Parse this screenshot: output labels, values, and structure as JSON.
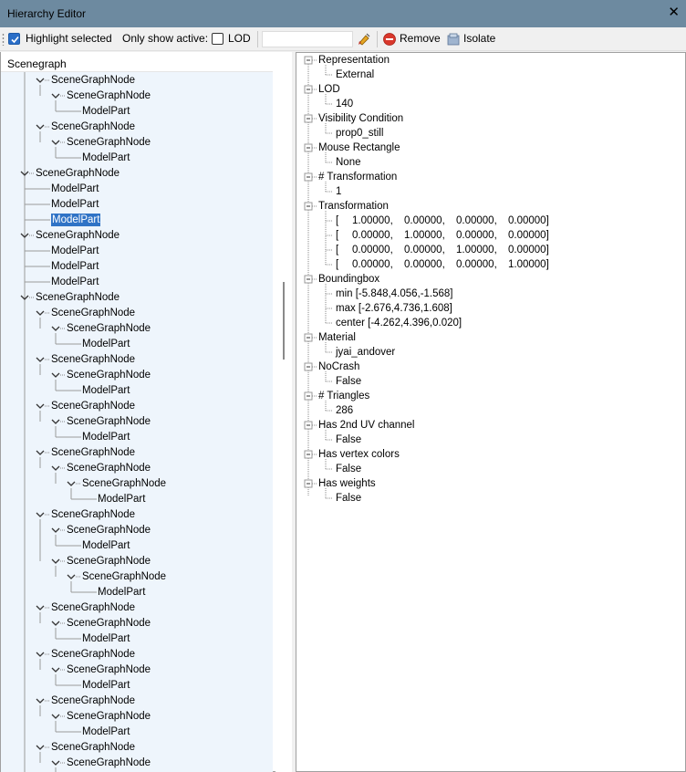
{
  "window": {
    "title": "Hierarchy Editor",
    "close_symbol": "✕"
  },
  "toolbar": {
    "highlight_label": "Highlight selected",
    "only_active_label": "Only show active:",
    "lod_label": "LOD",
    "search_value": "",
    "remove_label": "Remove",
    "isolate_label": "Isolate"
  },
  "tree": {
    "header": "Scenegraph",
    "rows": [
      {
        "level": 1,
        "label": "SceneGraphNode",
        "expander": "expanded"
      },
      {
        "level": 2,
        "label": "SceneGraphNode",
        "expander": "expanded"
      },
      {
        "level": 3,
        "label": "ModelPart",
        "expander": "none"
      },
      {
        "level": 1,
        "label": "SceneGraphNode",
        "expander": "expanded"
      },
      {
        "level": 2,
        "label": "SceneGraphNode",
        "expander": "expanded"
      },
      {
        "level": 3,
        "label": "ModelPart",
        "expander": "none"
      },
      {
        "level": 0,
        "label": "SceneGraphNode",
        "expander": "expanded"
      },
      {
        "level": 1,
        "label": "ModelPart",
        "expander": "none"
      },
      {
        "level": 1,
        "label": "ModelPart",
        "expander": "none"
      },
      {
        "level": 1,
        "label": "ModelPart",
        "expander": "none",
        "selected": true
      },
      {
        "level": 0,
        "label": "SceneGraphNode",
        "expander": "expanded"
      },
      {
        "level": 1,
        "label": "ModelPart",
        "expander": "none"
      },
      {
        "level": 1,
        "label": "ModelPart",
        "expander": "none"
      },
      {
        "level": 1,
        "label": "ModelPart",
        "expander": "none"
      },
      {
        "level": 0,
        "label": "SceneGraphNode",
        "expander": "expanded"
      },
      {
        "level": 1,
        "label": "SceneGraphNode",
        "expander": "expanded"
      },
      {
        "level": 2,
        "label": "SceneGraphNode",
        "expander": "expanded"
      },
      {
        "level": 3,
        "label": "ModelPart",
        "expander": "none"
      },
      {
        "level": 1,
        "label": "SceneGraphNode",
        "expander": "expanded"
      },
      {
        "level": 2,
        "label": "SceneGraphNode",
        "expander": "expanded"
      },
      {
        "level": 3,
        "label": "ModelPart",
        "expander": "none"
      },
      {
        "level": 1,
        "label": "SceneGraphNode",
        "expander": "expanded"
      },
      {
        "level": 2,
        "label": "SceneGraphNode",
        "expander": "expanded"
      },
      {
        "level": 3,
        "label": "ModelPart",
        "expander": "none"
      },
      {
        "level": 1,
        "label": "SceneGraphNode",
        "expander": "expanded"
      },
      {
        "level": 2,
        "label": "SceneGraphNode",
        "expander": "expanded"
      },
      {
        "level": 3,
        "label": "SceneGraphNode",
        "expander": "expanded"
      },
      {
        "level": 4,
        "label": "ModelPart",
        "expander": "none"
      },
      {
        "level": 1,
        "label": "SceneGraphNode",
        "expander": "expanded"
      },
      {
        "level": 2,
        "label": "SceneGraphNode",
        "expander": "expanded"
      },
      {
        "level": 3,
        "label": "ModelPart",
        "expander": "none"
      },
      {
        "level": 2,
        "label": "SceneGraphNode",
        "expander": "expanded"
      },
      {
        "level": 3,
        "label": "SceneGraphNode",
        "expander": "expanded"
      },
      {
        "level": 4,
        "label": "ModelPart",
        "expander": "none"
      },
      {
        "level": 1,
        "label": "SceneGraphNode",
        "expander": "expanded"
      },
      {
        "level": 2,
        "label": "SceneGraphNode",
        "expander": "expanded"
      },
      {
        "level": 3,
        "label": "ModelPart",
        "expander": "none"
      },
      {
        "level": 1,
        "label": "SceneGraphNode",
        "expander": "expanded"
      },
      {
        "level": 2,
        "label": "SceneGraphNode",
        "expander": "expanded"
      },
      {
        "level": 3,
        "label": "ModelPart",
        "expander": "none"
      },
      {
        "level": 1,
        "label": "SceneGraphNode",
        "expander": "expanded"
      },
      {
        "level": 2,
        "label": "SceneGraphNode",
        "expander": "expanded"
      },
      {
        "level": 3,
        "label": "ModelPart",
        "expander": "none"
      },
      {
        "level": 1,
        "label": "SceneGraphNode",
        "expander": "expanded"
      },
      {
        "level": 2,
        "label": "SceneGraphNode",
        "expander": "expanded"
      }
    ]
  },
  "properties": [
    {
      "name": "Representation",
      "values": [
        "External"
      ]
    },
    {
      "name": "LOD",
      "values": [
        "140"
      ]
    },
    {
      "name": "Visibility Condition",
      "values": [
        "prop0_still"
      ]
    },
    {
      "name": "Mouse Rectangle",
      "values": [
        "None"
      ]
    },
    {
      "name": "# Transformation",
      "values": [
        "1"
      ]
    },
    {
      "name": "Transformation",
      "matrix": [
        [
          "1.00000,",
          "0.00000,",
          "0.00000,",
          "0.00000]"
        ],
        [
          "0.00000,",
          "1.00000,",
          "0.00000,",
          "0.00000]"
        ],
        [
          "0.00000,",
          "0.00000,",
          "1.00000,",
          "0.00000]"
        ],
        [
          "0.00000,",
          "0.00000,",
          "0.00000,",
          "1.00000]"
        ]
      ]
    },
    {
      "name": "Boundingbox",
      "values": [
        "min [-5.848,4.056,-1.568]",
        "max [-2.676,4.736,1.608]",
        "center [-4.262,4.396,0.020]"
      ]
    },
    {
      "name": "Material",
      "values": [
        "jyai_andover"
      ]
    },
    {
      "name": "NoCrash",
      "values": [
        "False"
      ]
    },
    {
      "name": "# Triangles",
      "values": [
        "286"
      ]
    },
    {
      "name": "Has 2nd UV channel",
      "values": [
        "False"
      ]
    },
    {
      "name": "Has vertex colors",
      "values": [
        "False"
      ]
    },
    {
      "name": "Has weights",
      "values": [
        "False"
      ]
    }
  ],
  "colors": {
    "titlebar": "#6d8aa0",
    "selection": "#2f73c6",
    "tree_background": "#eef5fc"
  }
}
